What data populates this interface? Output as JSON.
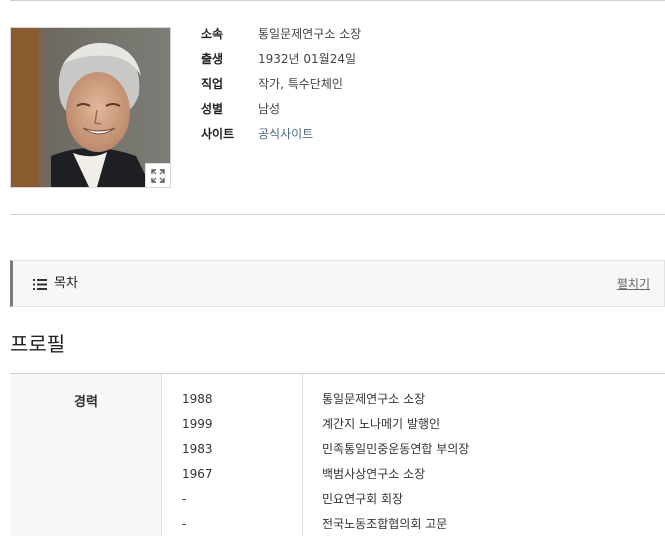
{
  "photo": {
    "alt": "profile-photo",
    "expand_icon": "expand-icon"
  },
  "info": [
    {
      "label": "소속",
      "value": "통일문제연구소 소장",
      "is_link": false
    },
    {
      "label": "출생",
      "value": "1932년 01월24일",
      "is_link": false
    },
    {
      "label": "직업",
      "value": "작가, 특수단체인",
      "is_link": false
    },
    {
      "label": "성별",
      "value": "남성",
      "is_link": false
    },
    {
      "label": "사이트",
      "value": "공식사이트",
      "is_link": true
    }
  ],
  "toc": {
    "title": "목차",
    "toggle": "펼치기",
    "icon": "list-icon"
  },
  "profile": {
    "title": "프로필",
    "career_label": "경력",
    "career": [
      {
        "year": "1988",
        "desc": "통일문제연구소 소장"
      },
      {
        "year": "1999",
        "desc": "계간지 노나메기 발행인"
      },
      {
        "year": "1983",
        "desc": "민족통일민중운동연합 부의장"
      },
      {
        "year": "1967",
        "desc": "백범사상연구소 소장"
      },
      {
        "year": "-",
        "desc": "민요연구회 회장"
      },
      {
        "year": "-",
        "desc": "전국노동조합협의회 고문"
      }
    ]
  },
  "colors": {
    "link": "#4b6880",
    "rule": "#cfcfcf",
    "toc_bg": "#f7f7f7",
    "toc_accent": "#7c7c7c"
  }
}
